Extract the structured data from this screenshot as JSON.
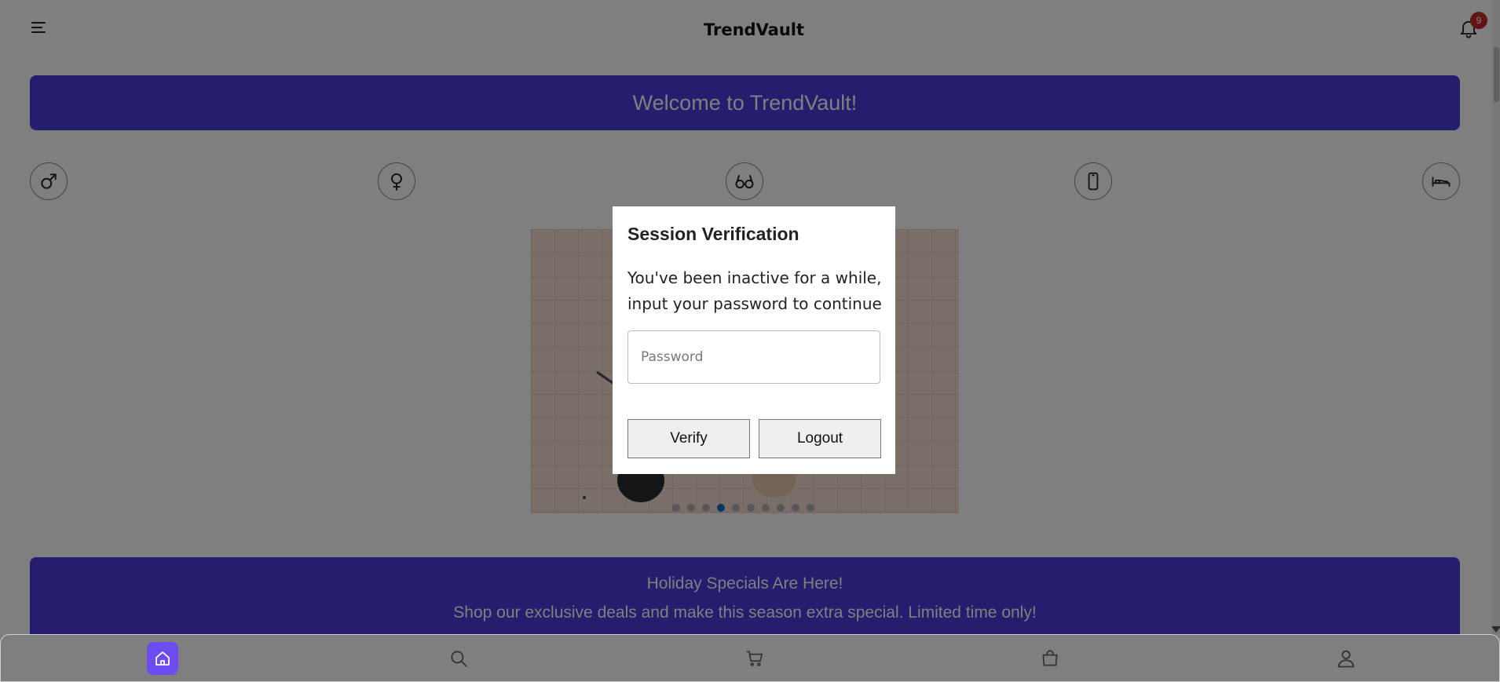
{
  "header": {
    "title": "TrendVault",
    "notification_count": "9",
    "menu_icon": "hamburger-menu-icon",
    "bell_icon": "bell-icon"
  },
  "welcome_banner": {
    "text": "Welcome to TrendVault!"
  },
  "categories": [
    {
      "icon": "male-symbol-icon"
    },
    {
      "icon": "female-symbol-icon"
    },
    {
      "icon": "glasses-icon"
    },
    {
      "icon": "smartphone-icon"
    },
    {
      "icon": "bed-icon"
    }
  ],
  "carousel": {
    "slide_count": 10,
    "active_index": 3
  },
  "promo": {
    "title": "Holiday Specials Are Here!",
    "text": "Shop our exclusive deals and make this season extra special. Limited time only!"
  },
  "bottom_nav": [
    {
      "icon": "home-icon",
      "active": true
    },
    {
      "icon": "search-icon",
      "active": false
    },
    {
      "icon": "cart-icon",
      "active": false
    },
    {
      "icon": "shopping-bag-icon",
      "active": false
    },
    {
      "icon": "user-icon",
      "active": false
    }
  ],
  "modal": {
    "title": "Session Verification",
    "message": "You've been inactive for a while, input your password to continue",
    "password_placeholder": "Password",
    "verify_label": "Verify",
    "logout_label": "Logout"
  },
  "colors": {
    "accent": "#4b3bdc",
    "nav_active": "#6c4cf1",
    "badge": "#c62828",
    "dot_active": "#1565c0"
  }
}
